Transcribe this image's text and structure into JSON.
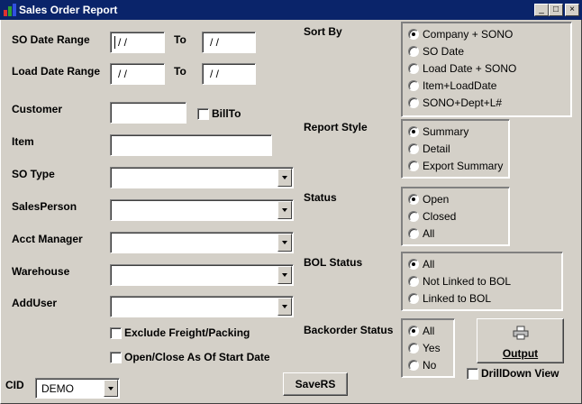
{
  "window": {
    "title": "Sales Order Report",
    "controls": {
      "minimize": "_",
      "maximize": "□",
      "close": "×"
    }
  },
  "form": {
    "so_date_range": {
      "label": "SO Date Range",
      "from": "/ /",
      "to_label": "To",
      "to": "/ /"
    },
    "load_date_range": {
      "label": "Load Date Range",
      "from": "/ /",
      "to_label": "To",
      "to": "/ /"
    },
    "customer": {
      "label": "Customer",
      "value": "",
      "billto_label": "BillTo",
      "billto_checked": false
    },
    "item": {
      "label": "Item",
      "value": ""
    },
    "so_type": {
      "label": "SO Type",
      "value": ""
    },
    "salesperson": {
      "label": "SalesPerson",
      "value": ""
    },
    "acct_manager": {
      "label": "Acct Manager",
      "value": ""
    },
    "warehouse": {
      "label": "Warehouse",
      "value": ""
    },
    "adduser": {
      "label": "AddUser",
      "value": ""
    },
    "exclude_freight": {
      "label": "Exclude Freight/Packing",
      "checked": false
    },
    "open_close": {
      "label": "Open/Close As Of Start Date",
      "checked": false
    },
    "cid": {
      "label": "CID",
      "value": "DEMO"
    }
  },
  "sort_by": {
    "label": "Sort By",
    "options": [
      "Company + SONO",
      "SO Date",
      "Load Date + SONO",
      "Item+LoadDate",
      "SONO+Dept+L#"
    ],
    "selected": 0
  },
  "report_style": {
    "label": "Report  Style",
    "options": [
      "Summary",
      "Detail",
      "Export Summary"
    ],
    "selected": 0
  },
  "status": {
    "label": "Status",
    "options": [
      "Open",
      "Closed",
      "All"
    ],
    "selected": 0
  },
  "bol_status": {
    "label": "BOL Status",
    "options": [
      "All",
      "Not Linked to BOL",
      "Linked to BOL"
    ],
    "selected": 0
  },
  "backorder_status": {
    "label": "Backorder Status",
    "options": [
      "All",
      "Yes",
      "No"
    ],
    "selected": 0
  },
  "buttons": {
    "output": "Output",
    "savers": "SaveRS"
  },
  "drilldown": {
    "label": "DrillDown View",
    "checked": false
  },
  "icons": {
    "app": "app-icon",
    "printer": "printer-icon"
  }
}
